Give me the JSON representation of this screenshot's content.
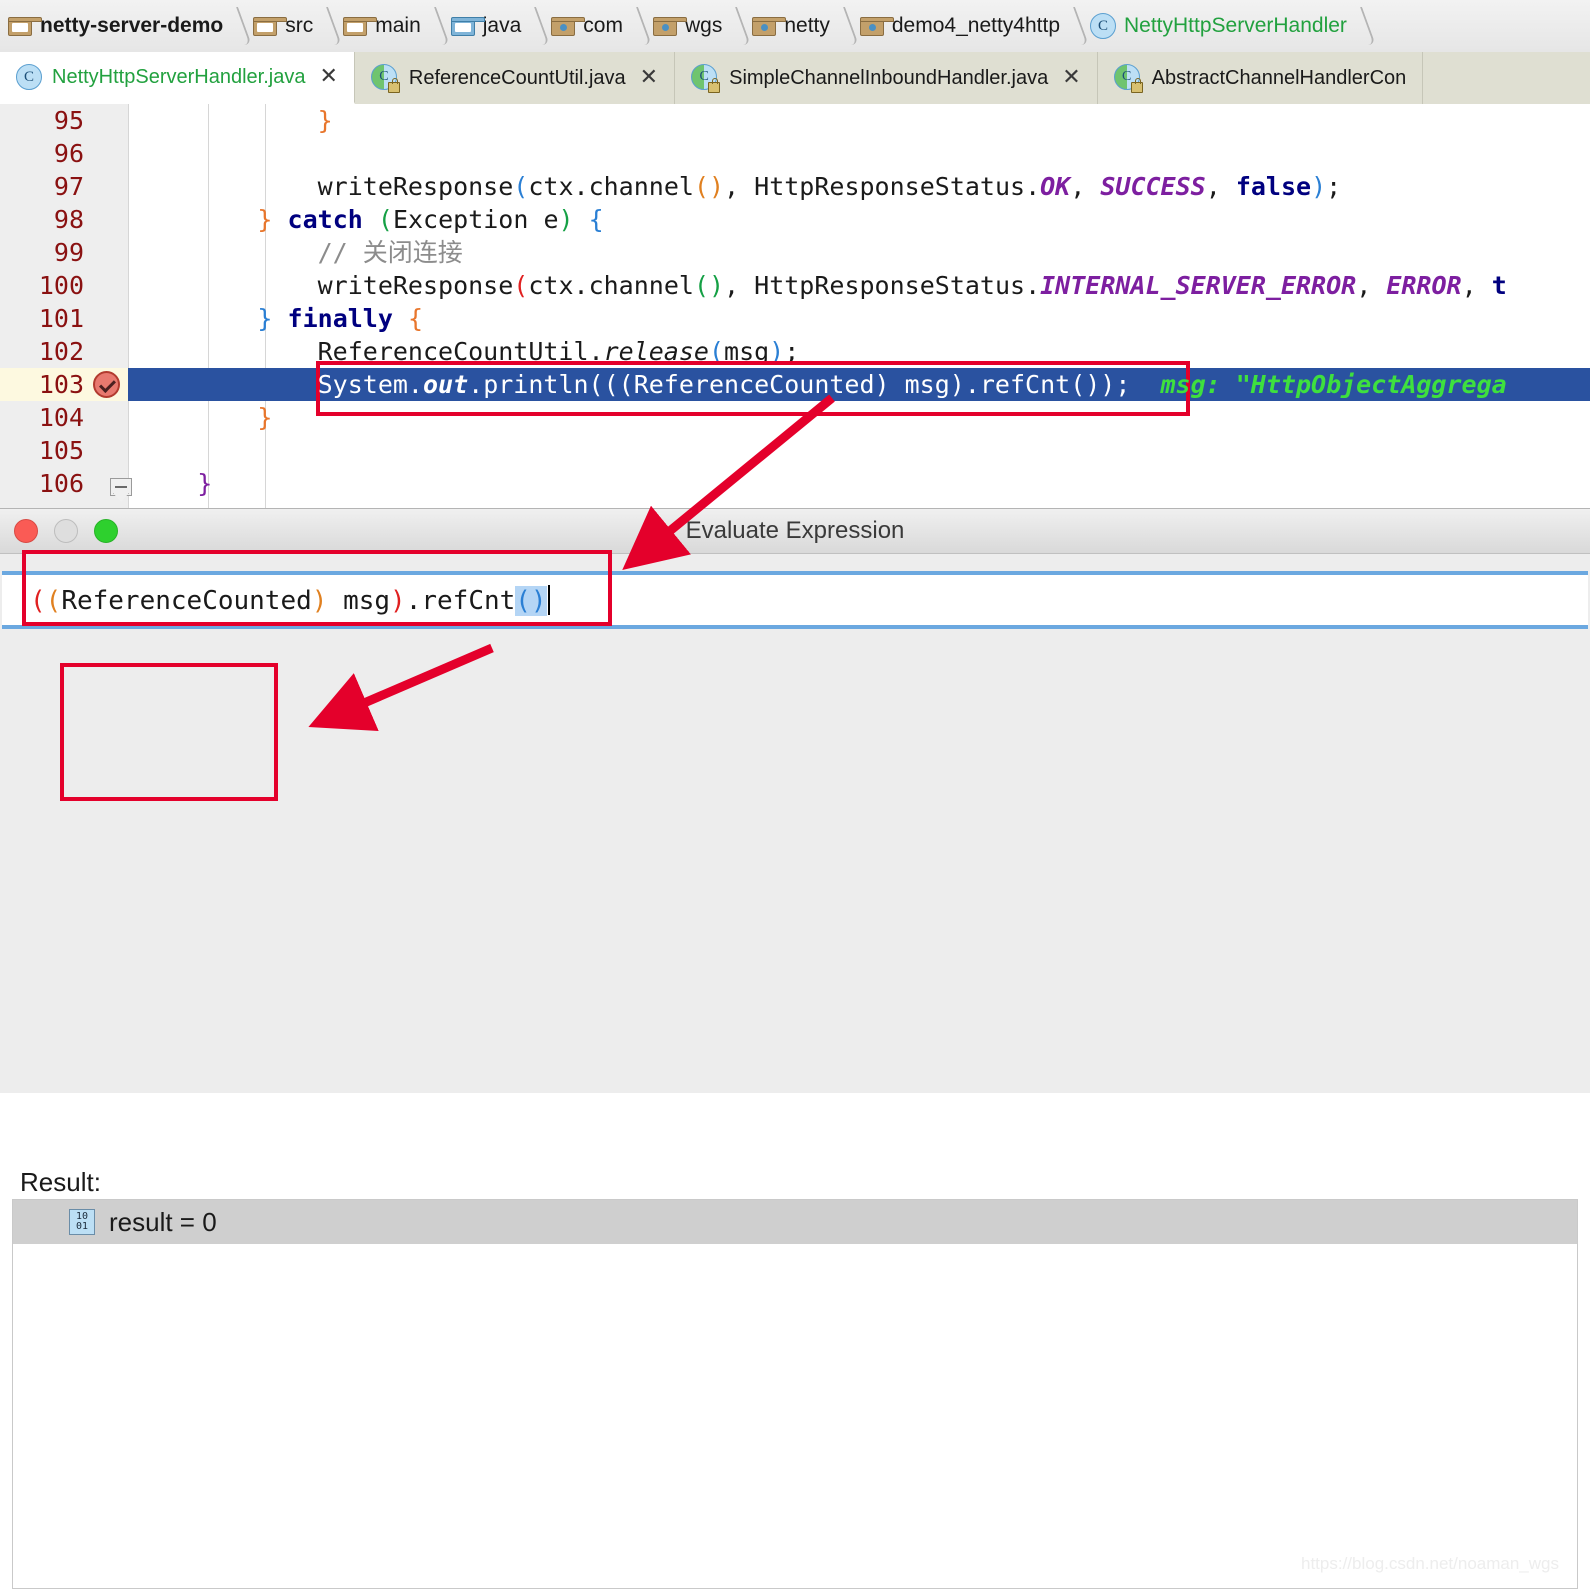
{
  "breadcrumb": {
    "items": [
      {
        "label": "netty-server-demo",
        "icon": "module-icon"
      },
      {
        "label": "src",
        "icon": "folder-icon"
      },
      {
        "label": "main",
        "icon": "folder-icon"
      },
      {
        "label": "java",
        "icon": "source-folder-icon"
      },
      {
        "label": "com",
        "icon": "package-icon"
      },
      {
        "label": "wgs",
        "icon": "package-icon"
      },
      {
        "label": "netty",
        "icon": "package-icon"
      },
      {
        "label": "demo4_netty4http",
        "icon": "package-icon"
      },
      {
        "label": "NettyHttpServerHandler",
        "icon": "class-icon"
      }
    ]
  },
  "tabs": [
    {
      "label": "NettyHttpServerHandler.java",
      "icon": "class-icon",
      "close": "✕",
      "active": true
    },
    {
      "label": "ReferenceCountUtil.java",
      "icon": "library-class-icon",
      "close": "✕",
      "active": false
    },
    {
      "label": "SimpleChannelInboundHandler.java",
      "icon": "library-class-icon",
      "close": "✕",
      "active": false
    },
    {
      "label": "AbstractChannelHandlerCon",
      "icon": "library-class-icon",
      "close": "",
      "active": false
    }
  ],
  "editor": {
    "lines": [
      {
        "n": "95",
        "text": "            }"
      },
      {
        "n": "96",
        "text": ""
      },
      {
        "n": "97",
        "text": "            writeResponse(ctx.channel(), HttpResponseStatus.OK, SUCCESS, false);"
      },
      {
        "n": "98",
        "text": "        } catch (Exception e) {"
      },
      {
        "n": "99",
        "text": "            // 关闭连接"
      },
      {
        "n": "100",
        "text": "            writeResponse(ctx.channel(), HttpResponseStatus.INTERNAL_SERVER_ERROR, ERROR, t"
      },
      {
        "n": "101",
        "text": "        } finally {"
      },
      {
        "n": "102",
        "text": "            ReferenceCountUtil.release(msg);"
      },
      {
        "n": "103",
        "text": "            System.out.println(((ReferenceCounted) msg).refCnt());",
        "current": true,
        "breakpoint": "breakpoint-icon",
        "inline_hint": "msg: \"HttpObjectAggrega"
      },
      {
        "n": "104",
        "text": "        }"
      },
      {
        "n": "105",
        "text": ""
      },
      {
        "n": "106",
        "text": "    }"
      }
    ]
  },
  "dialog": {
    "title": "Evaluate Expression",
    "window_buttons": [
      "close",
      "minimize",
      "zoom"
    ],
    "expression": {
      "value": "((ReferenceCounted) msg).refCnt()",
      "selected_fragment": "()"
    },
    "result_label": "Result:",
    "result": {
      "icon": "binary-value-icon",
      "icon_top": "10",
      "icon_bottom": "01",
      "text": "result = 0"
    }
  },
  "annotations": {
    "accent_color": "#e4002b",
    "boxes": [
      "code-line-103-box",
      "expression-input-box",
      "result-value-box"
    ],
    "arrows": [
      "code-to-expression-arrow",
      "expression-to-result-arrow"
    ]
  },
  "watermark": "https://blog.csdn.net/noaman_wgs"
}
